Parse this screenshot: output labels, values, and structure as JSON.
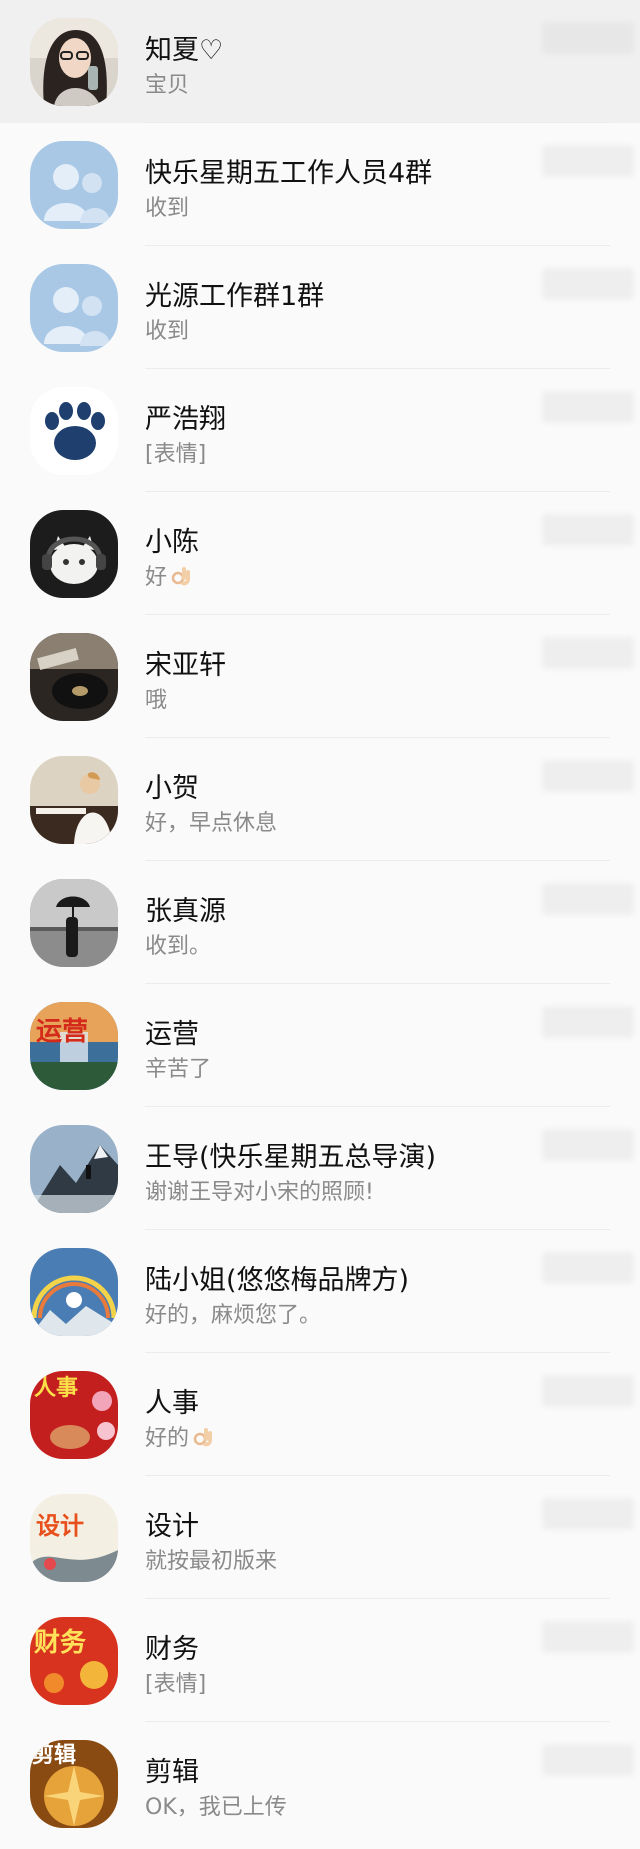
{
  "chats": [
    {
      "name": "知夏♡",
      "message": "宝贝",
      "avatar": "portrait-photo",
      "pinned": true
    },
    {
      "name": "快乐星期五工作人员4群",
      "message": "收到",
      "avatar": "group-icon"
    },
    {
      "name": "光源工作群1群",
      "message": "收到",
      "avatar": "group-icon"
    },
    {
      "name": "严浩翔",
      "message": "[表情]",
      "avatar": "paw-print"
    },
    {
      "name": "小陈",
      "message": "好",
      "avatar": "cat-headphones",
      "emoji": "ok-hand-icon"
    },
    {
      "name": "宋亚轩",
      "message": "哦",
      "avatar": "record-player"
    },
    {
      "name": "小贺",
      "message": "好，早点休息",
      "avatar": "piano-player"
    },
    {
      "name": "张真源",
      "message": "收到。",
      "avatar": "umbrella-silhouette"
    },
    {
      "name": "运营",
      "message": "辛苦了",
      "avatar": "waterfall-text-运营"
    },
    {
      "name": "王导(快乐星期五总导演)",
      "message": "谢谢王导对小宋的照顾!",
      "avatar": "mountain-climber"
    },
    {
      "name": "陆小姐(悠悠梅品牌方)",
      "message": "好的，麻烦您了。",
      "avatar": "rainbow-sky"
    },
    {
      "name": "人事",
      "message": "好的",
      "avatar": "flowers-text-人事",
      "emoji": "ok-hand-icon"
    },
    {
      "name": "设计",
      "message": "就按最初版来",
      "avatar": "ink-painting-text-设计"
    },
    {
      "name": "财务",
      "message": "[表情]",
      "avatar": "lanterns-text-财务"
    },
    {
      "name": "剪辑",
      "message": "OK，我已上传",
      "avatar": "golden-text-剪辑"
    }
  ],
  "colors": {
    "background": "#fafafa",
    "pinned_background": "#f0f0f0",
    "name_text": "#111111",
    "message_text": "#8a8a8a",
    "group_avatar": "#a9c8e6"
  }
}
